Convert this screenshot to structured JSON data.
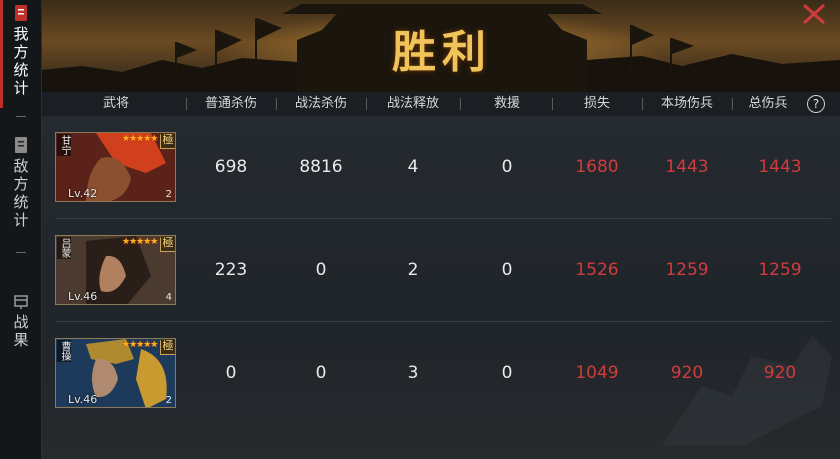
{
  "sidebar": {
    "tabs": [
      {
        "label": "我方统计",
        "icon": "scroll-icon",
        "active": true
      },
      {
        "label": "敌方统计",
        "icon": "scroll-icon",
        "active": false
      },
      {
        "label": "战果",
        "icon": "chest-icon",
        "active": false
      }
    ]
  },
  "banner": {
    "title": "胜利"
  },
  "table": {
    "headers": [
      "武将",
      "普通杀伤",
      "战法杀伤",
      "战法释放",
      "救援",
      "损失",
      "本场伤兵",
      "总伤兵"
    ],
    "help_label": "?",
    "rows": [
      {
        "name": "甘宁",
        "level": "Lv.42",
        "stars": "★★★★★",
        "rank": "極",
        "count": "2",
        "values": [
          "698",
          "8816",
          "4",
          "0",
          "1680",
          "1443",
          "1443"
        ]
      },
      {
        "name": "吕蒙",
        "level": "Lv.46",
        "stars": "★★★★★",
        "rank": "極",
        "count": "4",
        "values": [
          "223",
          "0",
          "2",
          "0",
          "1526",
          "1259",
          "1259"
        ]
      },
      {
        "name": "曹操",
        "level": "Lv.46",
        "stars": "★★★★★",
        "rank": "極",
        "count": "2",
        "values": [
          "0",
          "0",
          "3",
          "0",
          "1049",
          "920",
          "920"
        ]
      }
    ]
  },
  "colors": {
    "accent_red": "#d23b3b",
    "title_gold": "#f1c35b",
    "active_tab": "#c0302a"
  }
}
